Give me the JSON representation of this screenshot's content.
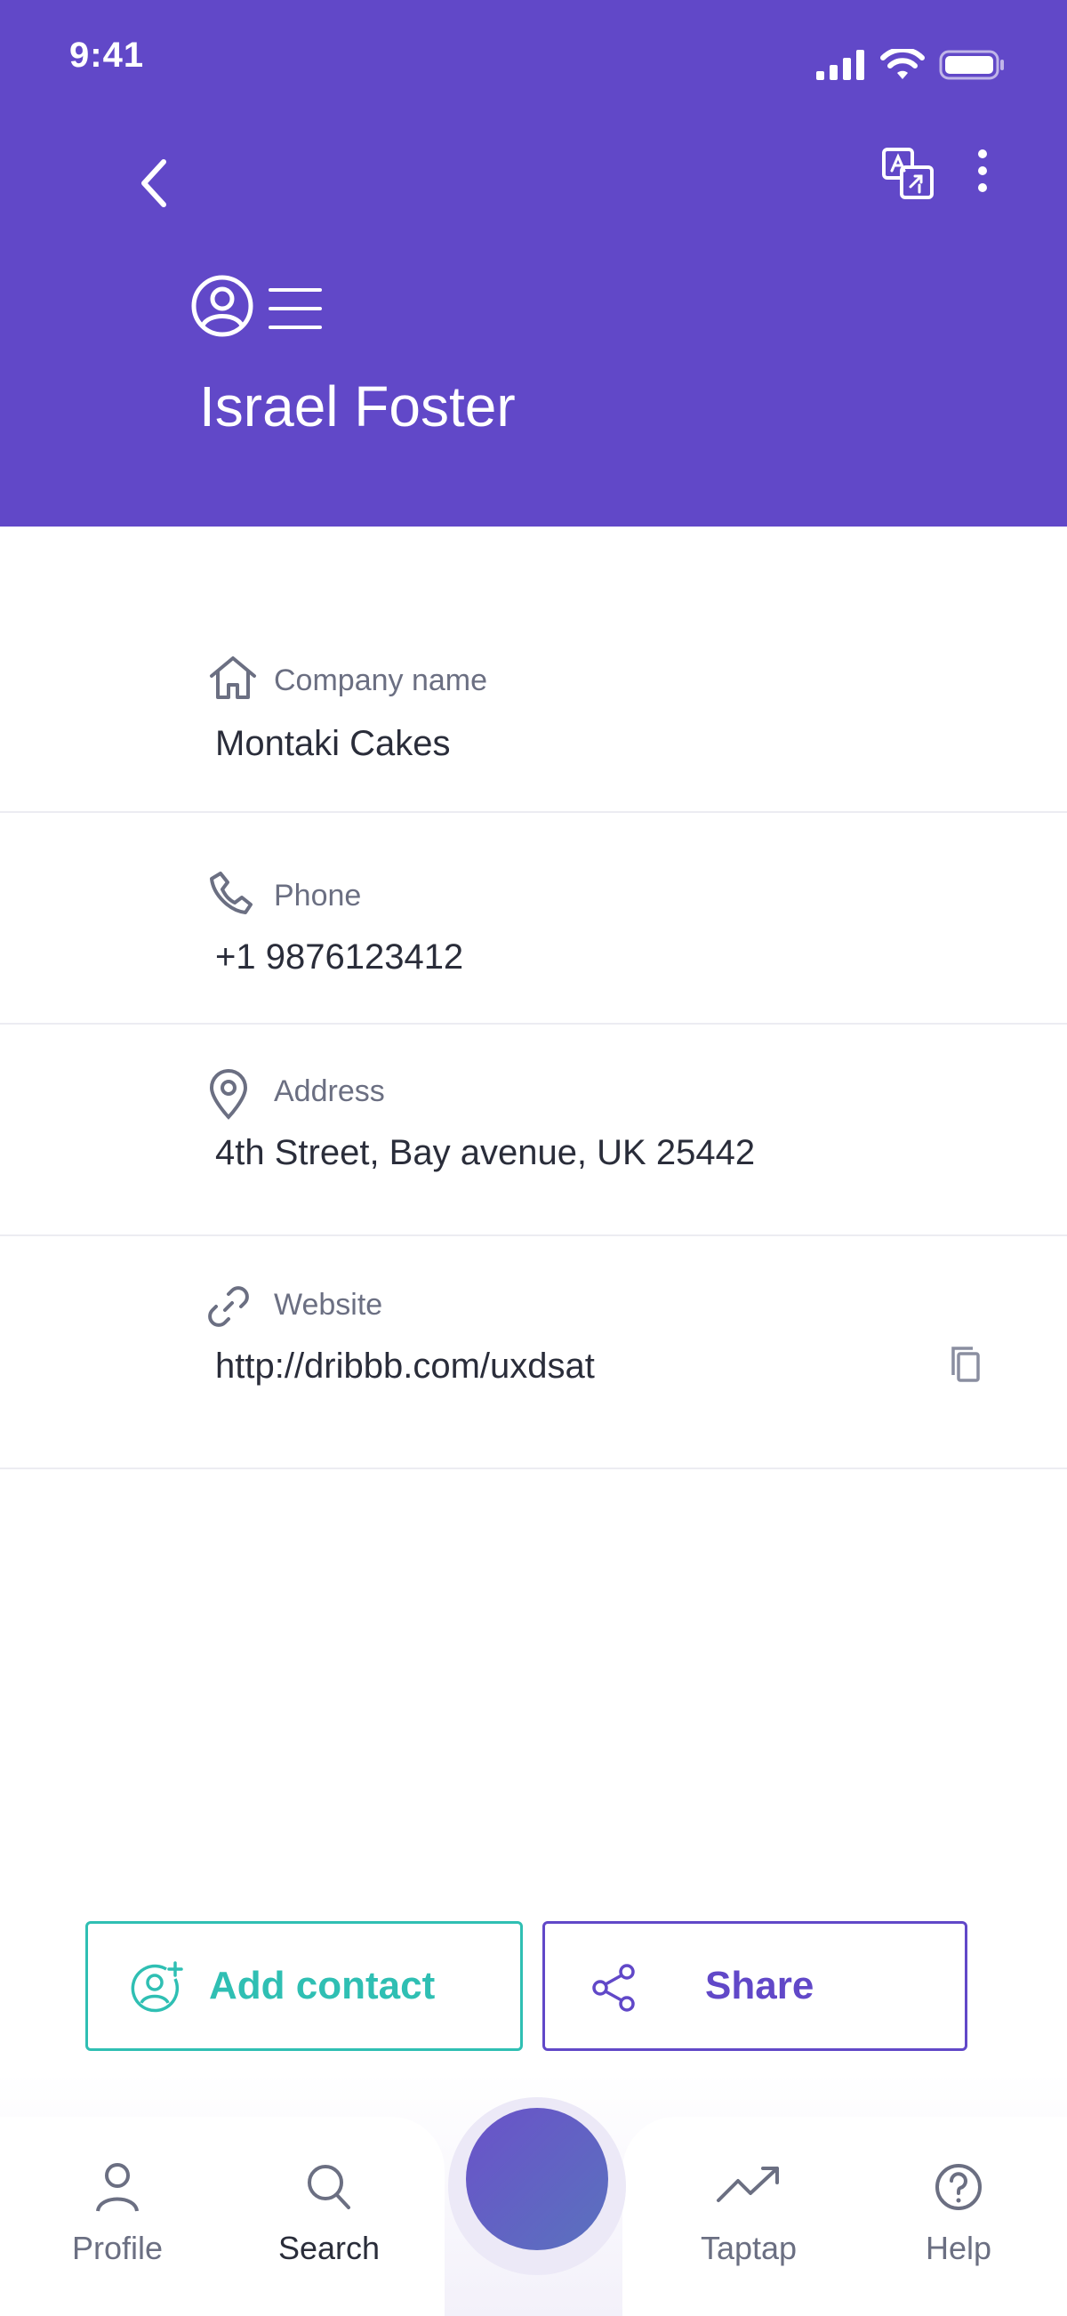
{
  "status_bar": {
    "time": "9:41"
  },
  "header": {
    "name": "Israel Foster",
    "accent_color": "#6148c8"
  },
  "fields": {
    "company": {
      "label": "Company name",
      "value": "Montaki Cakes",
      "icon": "home-icon"
    },
    "phone": {
      "label": "Phone",
      "value": "+1  9876123412",
      "icon": "phone-icon"
    },
    "address": {
      "label": "Address",
      "value": "4th Street, Bay avenue, UK 25442",
      "icon": "map-pin-icon"
    },
    "website": {
      "label": "Website",
      "value": "http://dribbb.com/uxdsat",
      "icon": "link-icon"
    }
  },
  "actions": {
    "add_contact": {
      "label": "Add contact",
      "color": "#2fbfb3"
    },
    "share": {
      "label": "Share",
      "color": "#6148c8"
    }
  },
  "nav": {
    "profile": "Profile",
    "search": "Search",
    "taptap": "Taptap",
    "help": "Help"
  }
}
